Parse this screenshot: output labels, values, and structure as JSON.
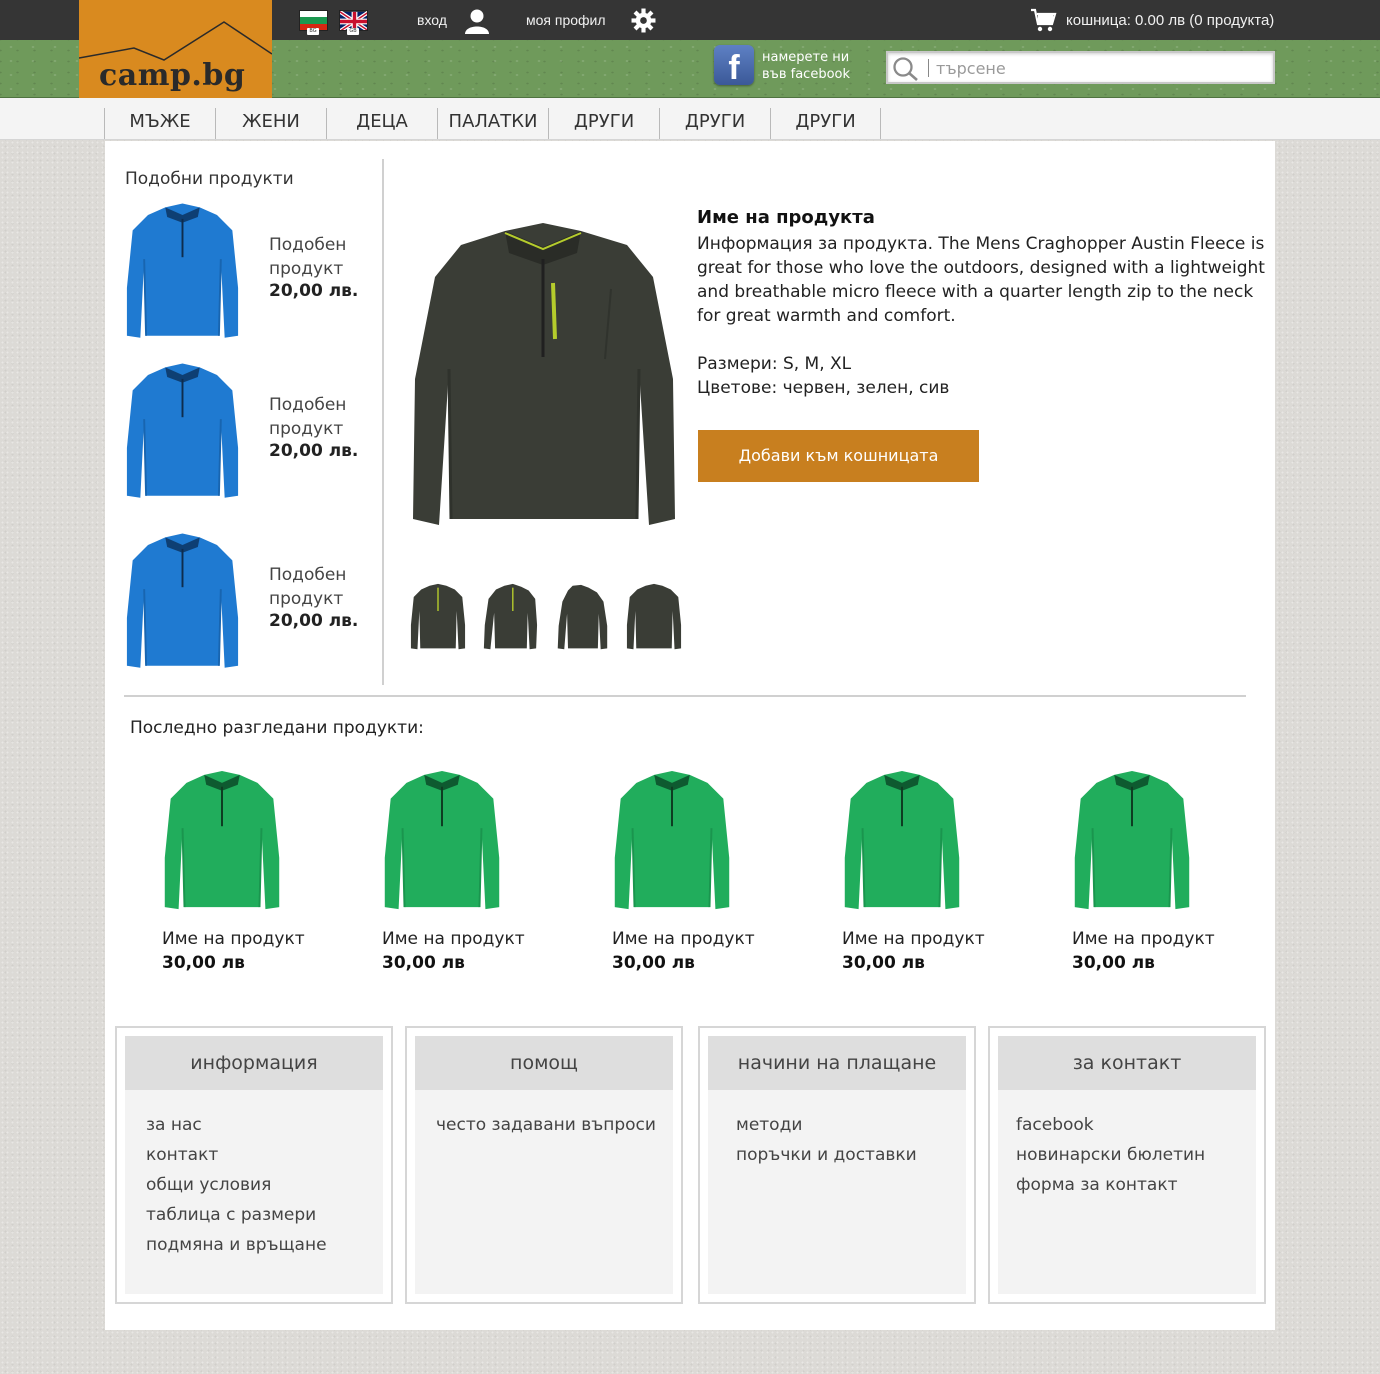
{
  "header": {
    "logo_text": "camp.bg",
    "flags": [
      {
        "code": "BG"
      },
      {
        "code": "GB"
      }
    ],
    "login_label": "вход",
    "profile_label": "моя профил",
    "cart_label": "кошница: 0.00 лв (0 продукта)",
    "facebook_text": "намерете ни във facebook",
    "search_placeholder": "търсене"
  },
  "nav": {
    "items": [
      "МЪЖЕ",
      "ЖЕНИ",
      "ДЕЦА",
      "ПАЛАТКИ",
      "ДРУГИ",
      "ДРУГИ",
      "ДРУГИ"
    ]
  },
  "similar": {
    "title": "Подобни продукти",
    "items": [
      {
        "name": "Подобен продукт",
        "price": "20,00 лв."
      },
      {
        "name": "Подобен продукт",
        "price": "20,00 лв."
      },
      {
        "name": "Подобен продукт",
        "price": "20,00 лв."
      }
    ]
  },
  "product": {
    "title": "Име на продукта",
    "description": "Информация за продукта. The Mens Craghopper Austin Fleece is great for those who love the outdoors, designed with a lightweight and breathable micro fleece with a quarter length zip to the neck for great warmth and comfort.",
    "sizes": "Размери: S, M, XL",
    "colors": "Цветове: червен, зелен, сив",
    "add_to_cart": "Добави към кошницата",
    "thumbnails": 4
  },
  "recent": {
    "title": "Последно разгледани продукти:",
    "items": [
      {
        "name": "Име на продукт",
        "price": "30,00 лв"
      },
      {
        "name": "Име на продукт",
        "price": "30,00 лв"
      },
      {
        "name": "Име на продукт",
        "price": "30,00 лв"
      },
      {
        "name": "Име на продукт",
        "price": "30,00 лв"
      },
      {
        "name": "Име на продукт",
        "price": "30,00 лв"
      }
    ]
  },
  "footer": [
    {
      "title": "информация",
      "links": [
        "за нас",
        "контакт",
        "общи условия",
        "таблица с размери",
        "подмяна и връщане"
      ]
    },
    {
      "title": "помощ",
      "links": [
        "често задавани въпроси"
      ]
    },
    {
      "title": "начини на плащане",
      "links": [
        "методи",
        "поръчки и доставки"
      ]
    },
    {
      "title": "за контакт",
      "links": [
        "facebook",
        "новинарски бюлетин",
        "форма за контакт"
      ]
    }
  ],
  "colors": {
    "topbar": "#353535",
    "header_green": "#6f9a5b",
    "logo_orange": "#d98a1f",
    "cart_button": "#c87f1f",
    "similar_jacket": "#1f7ad1",
    "recent_jacket": "#21ad5c",
    "main_jacket": "#3a3d36"
  },
  "icons": [
    "user-icon",
    "gear-icon",
    "cart-icon",
    "facebook-icon",
    "search-icon"
  ]
}
